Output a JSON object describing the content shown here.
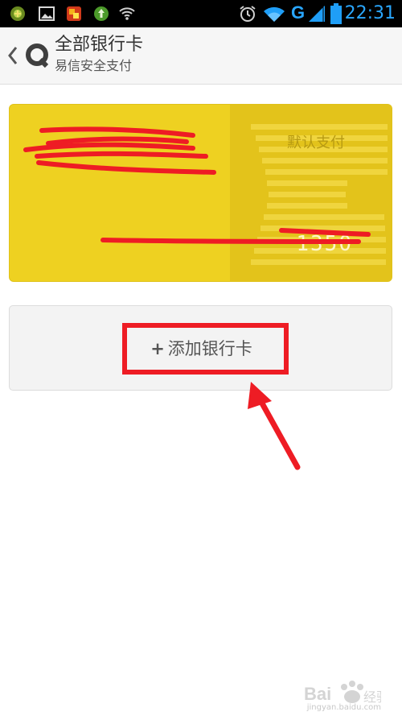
{
  "status_bar": {
    "network_type": "G",
    "time": "22:31",
    "icons": [
      "app-icon",
      "picture-icon",
      "app2-icon",
      "upload-icon",
      "wifi-icon",
      "alarm-icon",
      "wifi-icon",
      "signal-icon",
      "battery-icon"
    ]
  },
  "header": {
    "title": "全部银行卡",
    "subtitle": "易信安全支付"
  },
  "card": {
    "default_label": "默认支付",
    "number_tail": "1350"
  },
  "add_card": {
    "plus": "+",
    "label": "添加银行卡"
  },
  "watermark": {
    "brand": "Bai 经验",
    "url": "jingyan.baidu.com"
  },
  "colors": {
    "status_bar_bg": "#000000",
    "accent_blue": "#2aa7ff",
    "card_yellow": "#eed121",
    "annotation_red": "#ee1c24"
  }
}
